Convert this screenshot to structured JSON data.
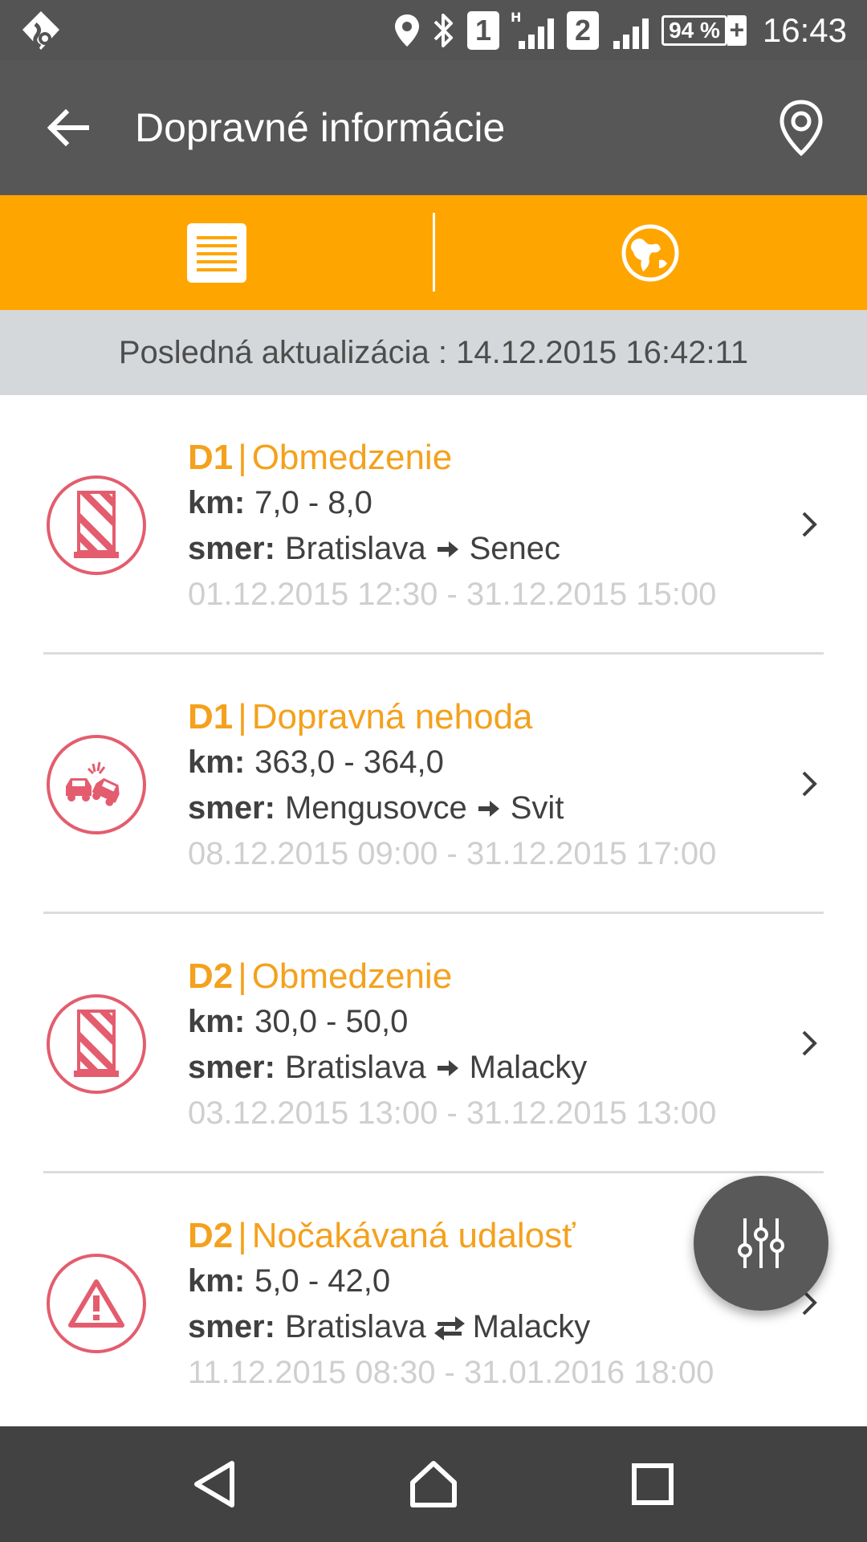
{
  "status_bar": {
    "sim1": "1",
    "sim2": "2",
    "network_type": "H",
    "battery": "94 %",
    "battery_charging": "+",
    "time": "16:43"
  },
  "app_bar": {
    "title": "Dopravné informácie",
    "back_icon": "arrow-left-icon",
    "action_icon": "map-pin-icon"
  },
  "tabs": [
    {
      "name": "list",
      "icon": "list-icon",
      "selected": true
    },
    {
      "name": "map",
      "icon": "globe-icon",
      "selected": false
    }
  ],
  "update": {
    "text": "Posledná aktualizácia : 14.12.2015 16:42:11"
  },
  "labels": {
    "km": "km:",
    "direction": "smer:",
    "separator": "|"
  },
  "items": [
    {
      "road": "D1",
      "type": "Obmedzenie",
      "icon": "roadblock-icon",
      "km": "7,0 - 8,0",
      "from": "Bratislava",
      "to": "Senec",
      "direction_icon": "one-way-arrow-icon",
      "time": "01.12.2015 12:30 - 31.12.2015 15:00"
    },
    {
      "road": "D1",
      "type": "Dopravná nehoda",
      "icon": "car-crash-icon",
      "km": "363,0 - 364,0",
      "from": "Mengusovce",
      "to": "Svit",
      "direction_icon": "one-way-arrow-icon",
      "time": "08.12.2015 09:00 - 31.12.2015 17:00"
    },
    {
      "road": "D2",
      "type": "Obmedzenie",
      "icon": "roadblock-icon",
      "km": "30,0 - 50,0",
      "from": "Bratislava",
      "to": "Malacky",
      "direction_icon": "one-way-arrow-icon",
      "time": "03.12.2015 13:00 - 31.12.2015 13:00"
    },
    {
      "road": "D2",
      "type": "Nočakávaná udalosť",
      "icon": "warning-triangle-icon",
      "km": "5,0 - 42,0",
      "from": "Bratislava",
      "to": "Malacky",
      "direction_icon": "two-way-arrow-icon",
      "time": "11.12.2015 08:30 - 31.01.2016 18:00"
    }
  ],
  "fab": {
    "icon": "filter-sliders-icon"
  },
  "nav_bar": {
    "back": "back-triangle-icon",
    "home": "home-icon",
    "recents": "recents-square-icon"
  },
  "colors": {
    "accent": "#ffa500",
    "title_orange": "#f4a11d",
    "icon_red": "#e35d6e",
    "app_bar": "#575757"
  }
}
